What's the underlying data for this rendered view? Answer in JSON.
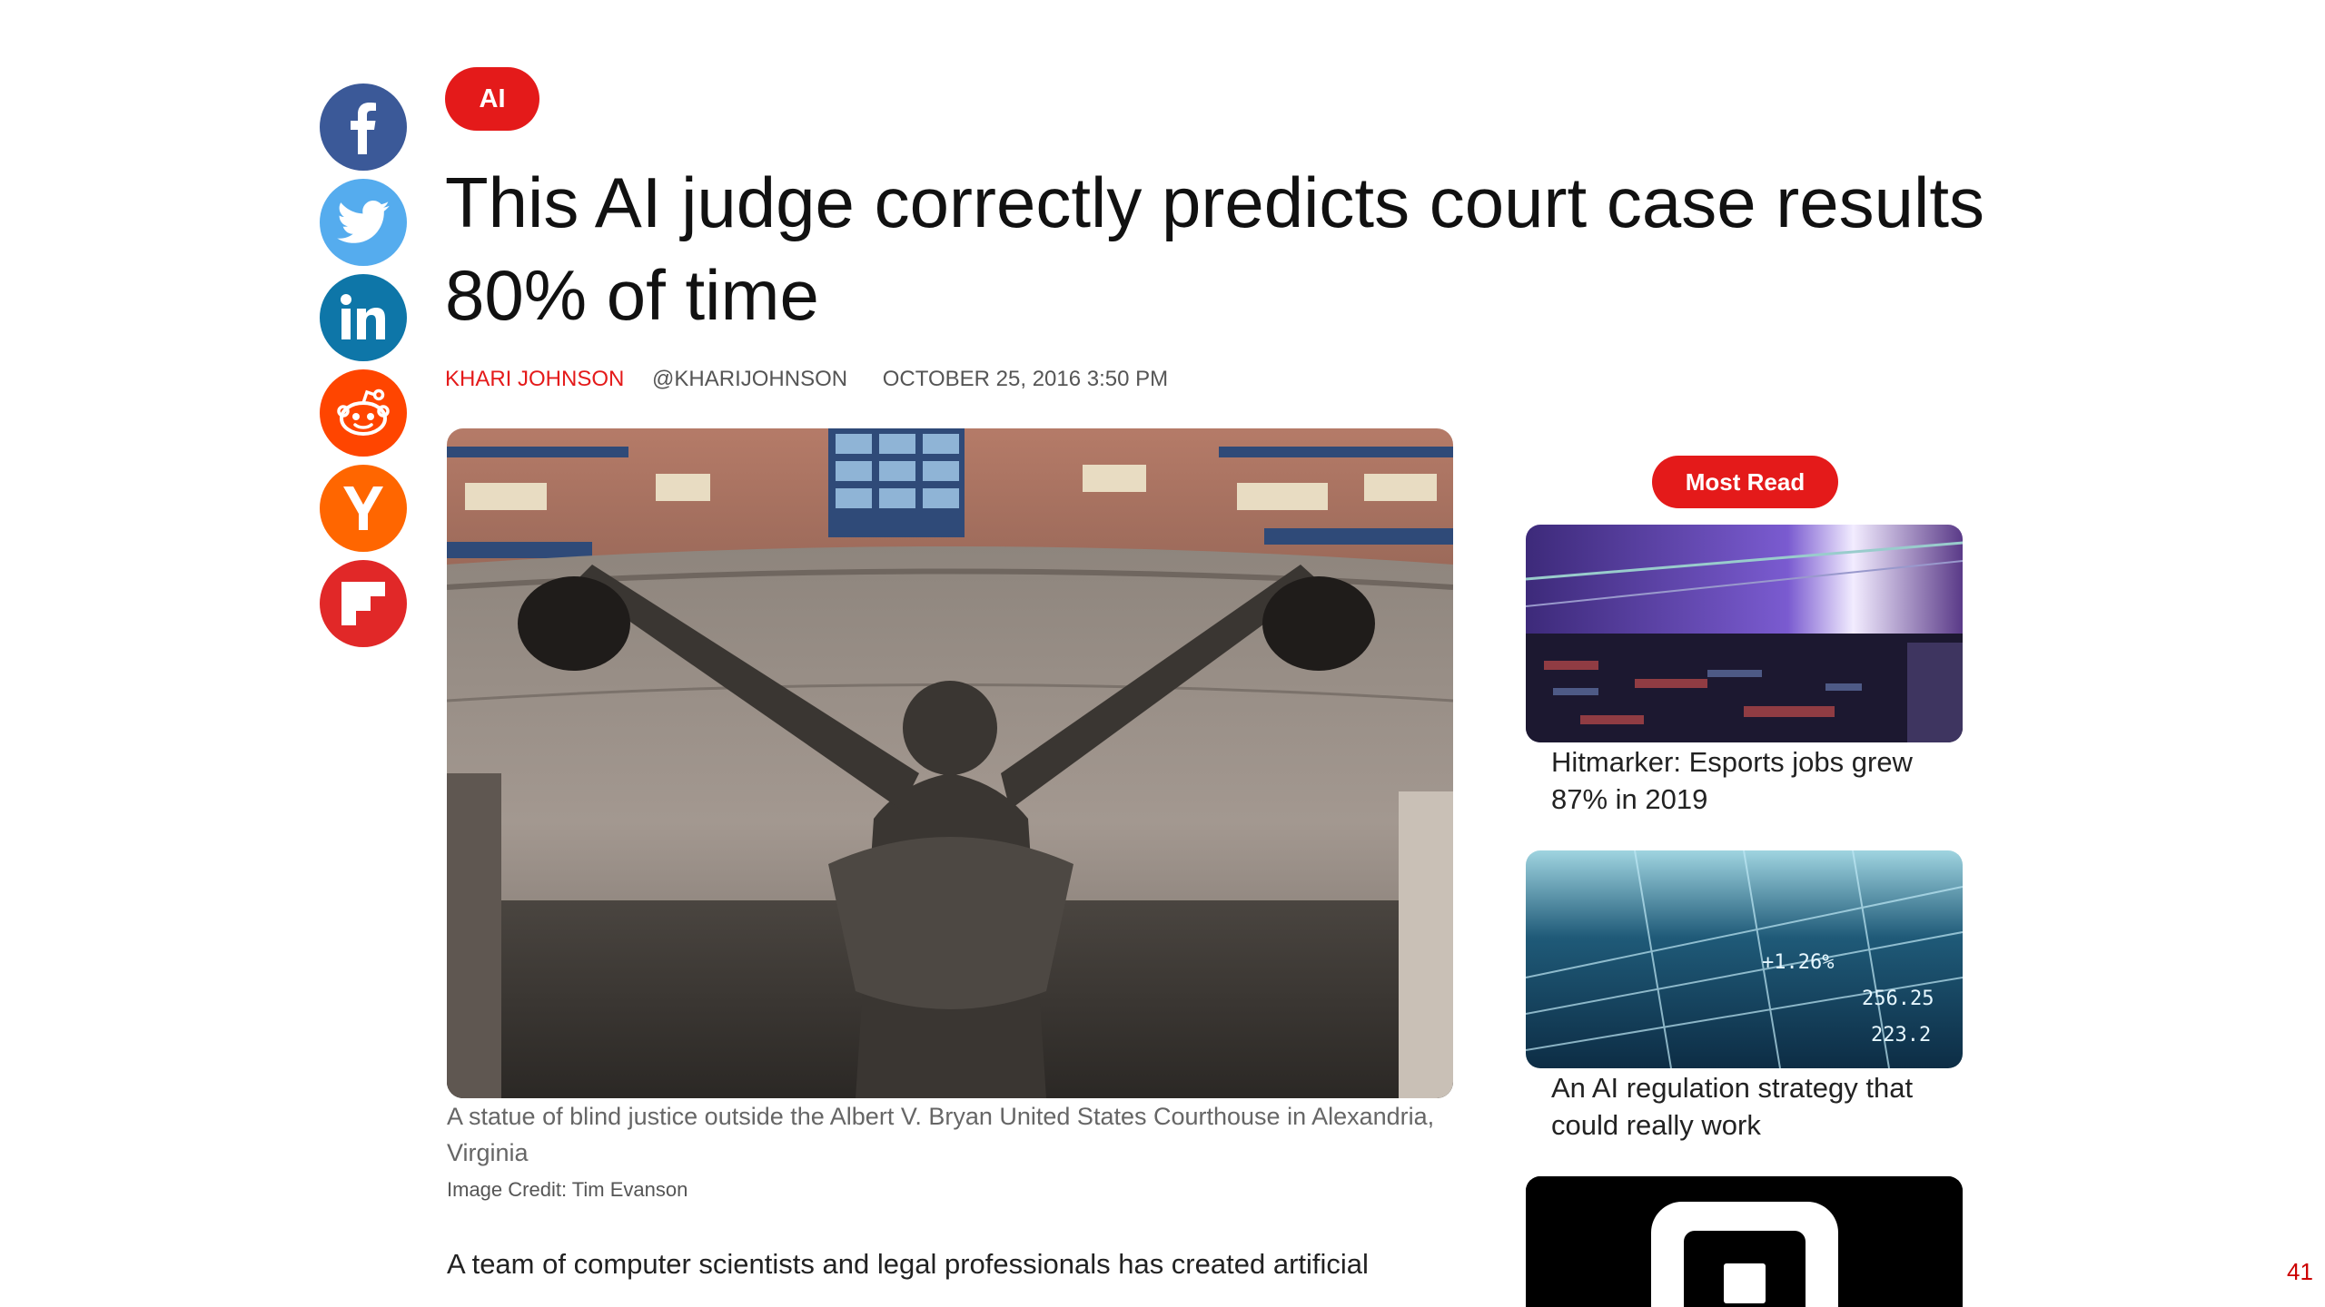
{
  "social": {
    "items": [
      {
        "name": "facebook",
        "color": "#3b5998"
      },
      {
        "name": "twitter",
        "color": "#55acee"
      },
      {
        "name": "linkedin",
        "color": "#0e76a8"
      },
      {
        "name": "reddit",
        "color": "#ff4500"
      },
      {
        "name": "hacker-news",
        "color": "#ff6600"
      },
      {
        "name": "flipboard",
        "color": "#e12828"
      }
    ]
  },
  "article": {
    "category": "AI",
    "title": "This AI judge correctly predicts court case results 80% of time",
    "author": "KHARI JOHNSON",
    "handle": "@KHARIJOHNSON",
    "date": "OCTOBER 25, 2016 3:50 PM",
    "image_caption": "A statue of blind justice outside the Albert V. Bryan United States Courthouse in Alexandria, Virginia",
    "image_credit": "Image Credit: Tim Evanson",
    "body_first_line": "A team of computer scientists and legal professionals has created artificial"
  },
  "sidebar": {
    "heading": "Most Read",
    "items": [
      {
        "title": "Hitmarker: Esports jobs grew 87% in 2019"
      },
      {
        "title": "An AI regulation strategy that could really work"
      }
    ]
  },
  "page_number": "41",
  "colors": {
    "accent": "#e41a1a"
  }
}
